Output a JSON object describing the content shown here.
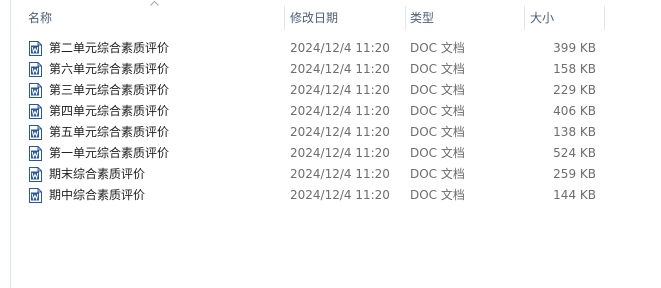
{
  "columns": {
    "name": "名称",
    "date": "修改日期",
    "type": "类型",
    "size": "大小"
  },
  "sort": {
    "column": "name",
    "direction": "ascending"
  },
  "colors": {
    "header_text": "#4c607a",
    "detail_text": "#6d6d6d",
    "name_text": "#1e1e1e",
    "icon_blue": "#2b5797"
  },
  "files": [
    {
      "name": "第二单元综合素质评价",
      "date": "2024/12/4 11:20",
      "type": "DOC 文档",
      "size": "399 KB",
      "icon": "word-doc-icon"
    },
    {
      "name": "第六单元综合素质评价",
      "date": "2024/12/4 11:20",
      "type": "DOC 文档",
      "size": "158 KB",
      "icon": "word-doc-icon"
    },
    {
      "name": "第三单元综合素质评价",
      "date": "2024/12/4 11:20",
      "type": "DOC 文档",
      "size": "229 KB",
      "icon": "word-doc-icon"
    },
    {
      "name": "第四单元综合素质评价",
      "date": "2024/12/4 11:20",
      "type": "DOC 文档",
      "size": "406 KB",
      "icon": "word-doc-icon"
    },
    {
      "name": "第五单元综合素质评价",
      "date": "2024/12/4 11:20",
      "type": "DOC 文档",
      "size": "138 KB",
      "icon": "word-doc-icon"
    },
    {
      "name": "第一单元综合素质评价",
      "date": "2024/12/4 11:20",
      "type": "DOC 文档",
      "size": "524 KB",
      "icon": "word-doc-icon"
    },
    {
      "name": "期末综合素质评价",
      "date": "2024/12/4 11:20",
      "type": "DOC 文档",
      "size": "259 KB",
      "icon": "word-doc-icon"
    },
    {
      "name": "期中综合素质评价",
      "date": "2024/12/4 11:20",
      "type": "DOC 文档",
      "size": "144 KB",
      "icon": "word-doc-icon"
    }
  ]
}
